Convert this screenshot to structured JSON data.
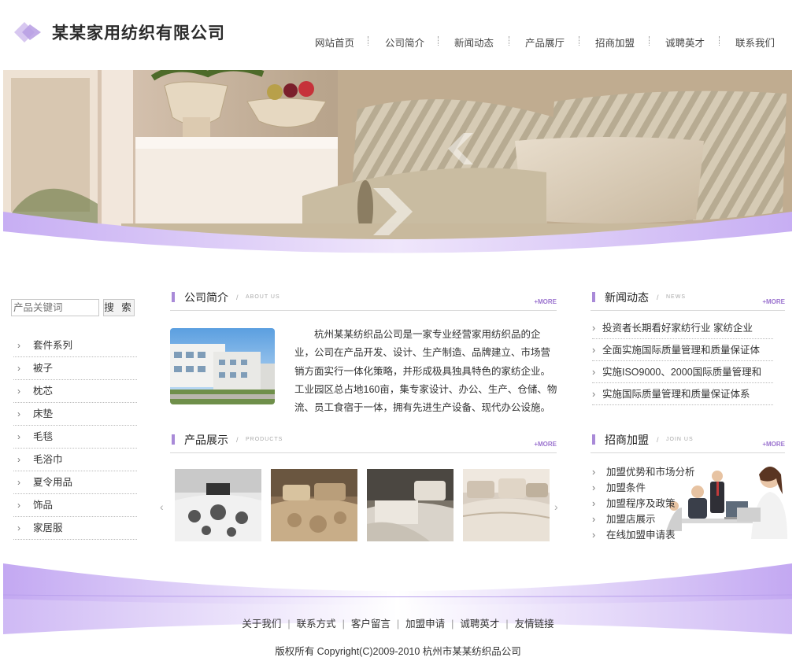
{
  "header": {
    "logo_text": "某某家用纺织有限公司",
    "nav": [
      {
        "label": "网站首页"
      },
      {
        "label": "公司简介"
      },
      {
        "label": "新闻动态"
      },
      {
        "label": "产品展厅"
      },
      {
        "label": "招商加盟"
      },
      {
        "label": "诚聘英才"
      },
      {
        "label": "联系我们"
      }
    ]
  },
  "search": {
    "placeholder": "产品关键词",
    "button_label": "搜 索"
  },
  "categories": [
    {
      "label": "套件系列"
    },
    {
      "label": "被子"
    },
    {
      "label": "枕芯"
    },
    {
      "label": "床垫"
    },
    {
      "label": "毛毯"
    },
    {
      "label": "毛浴巾"
    },
    {
      "label": "夏令用品"
    },
    {
      "label": "饰品"
    },
    {
      "label": "家居服"
    }
  ],
  "about": {
    "title": "公司简介",
    "en": "ABOUT US",
    "more": "+MORE",
    "text": "杭州某某纺织品公司是一家专业经营家用纺织品的企业，公司在产品开发、设计、生产制造、品牌建立、市场营销方面实行一体化策略，并形成极具独具特色的家纺企业。工业园区总占地160亩，集专家设计、办公、生产、仓储、物流、员工食宿于一体，拥有先进生产设备、现代办公设施。"
  },
  "products": {
    "title": "产品展示",
    "en": "PRODUCTS",
    "more": "+MORE",
    "prev": "‹",
    "next": "›"
  },
  "news": {
    "title": "新闻动态",
    "en": "NEWS",
    "more": "+MORE",
    "items": [
      {
        "label": "投资者长期看好家纺行业 家纺企业"
      },
      {
        "label": "全面实施国际质量管理和质量保证体"
      },
      {
        "label": "实施ISO9000、2000国际质量管理和"
      },
      {
        "label": "实施国际质量管理和质量保证体系"
      }
    ]
  },
  "join": {
    "title": "招商加盟",
    "en": "JOIN US",
    "more": "+MORE",
    "items": [
      {
        "label": "加盟优势和市场分析"
      },
      {
        "label": "加盟条件"
      },
      {
        "label": "加盟程序及政策"
      },
      {
        "label": "加盟店展示"
      },
      {
        "label": "在线加盟申请表"
      }
    ]
  },
  "footer": {
    "links": [
      {
        "label": "关于我们"
      },
      {
        "label": "联系方式"
      },
      {
        "label": "客户留言"
      },
      {
        "label": "加盟申请"
      },
      {
        "label": "诚聘英才"
      },
      {
        "label": "友情链接"
      }
    ],
    "separator": "|",
    "copyright": "版权所有  Copyright(C)2009-2010 杭州市某某纺织品公司"
  },
  "theme": {
    "accent": "#a98ad8",
    "more_color": "#9b73cf",
    "wave_color": "#c9b3f0"
  }
}
